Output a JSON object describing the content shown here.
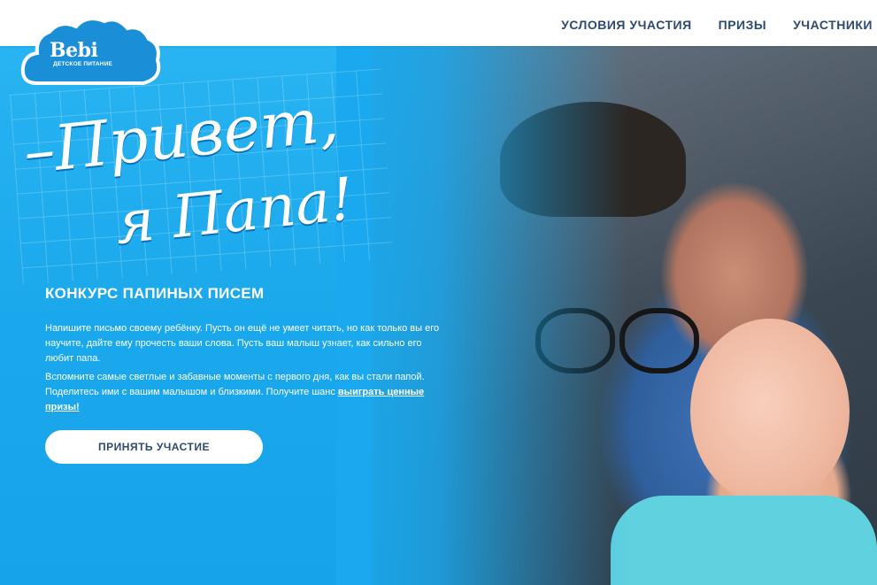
{
  "nav": {
    "items": [
      "УСЛОВИЯ УЧАСТИЯ",
      "ПРИЗЫ",
      "УЧАСТНИКИ"
    ]
  },
  "logo": {
    "brand": "Bebi",
    "subtitle": "ДЕТСКОЕ ПИТАНИЕ"
  },
  "hero": {
    "title_line1": "–Привет,",
    "title_line2": "я Папа!",
    "headline": "КОНКУРС ПАПИНЫХ ПИСЕМ",
    "paragraph1": "Напишите письмо своему ребёнку. Пусть он ещё не умеет читать, но как только вы его научите, дайте ему прочесть ваши слова. Пусть ваш малыш узнает, как сильно его любит папа.",
    "paragraph2_text": "Вспомните самые светлые и забавные моменты с первого дня, как вы стали папой. Поделитесь ими с вашим малышом и близкими. Получите шанс ",
    "paragraph2_link": "выиграть ценные призы!",
    "cta_label": "ПРИНЯТЬ УЧАСТИЕ"
  },
  "colors": {
    "accent_blue": "#1aa8ec",
    "nav_text": "#2d4a6f",
    "button_bg": "#ffffff"
  },
  "icons": [
    "cloud-logo-icon"
  ]
}
